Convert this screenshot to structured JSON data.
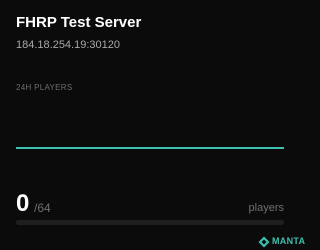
{
  "server": {
    "name": "FHRP Test Server",
    "address": "184.18.254.19:30120"
  },
  "chart": {
    "label": "24H PLAYERS",
    "line_color": "#3fbfae"
  },
  "players": {
    "current": "0",
    "max": "/64",
    "label": "players",
    "fill_fraction": 0
  },
  "brand": {
    "text": "MANTA",
    "icon": "manta-logo-icon",
    "color": "#3fbfae"
  },
  "chart_data": {
    "type": "line",
    "series": [
      {
        "values": [
          0,
          0,
          0,
          0,
          0,
          0,
          0,
          0,
          0,
          0,
          0,
          0,
          0,
          0,
          0,
          0,
          0,
          0,
          0,
          0,
          0,
          0,
          0,
          0
        ]
      }
    ],
    "ylim": [
      0,
      64
    ],
    "grid": false
  }
}
